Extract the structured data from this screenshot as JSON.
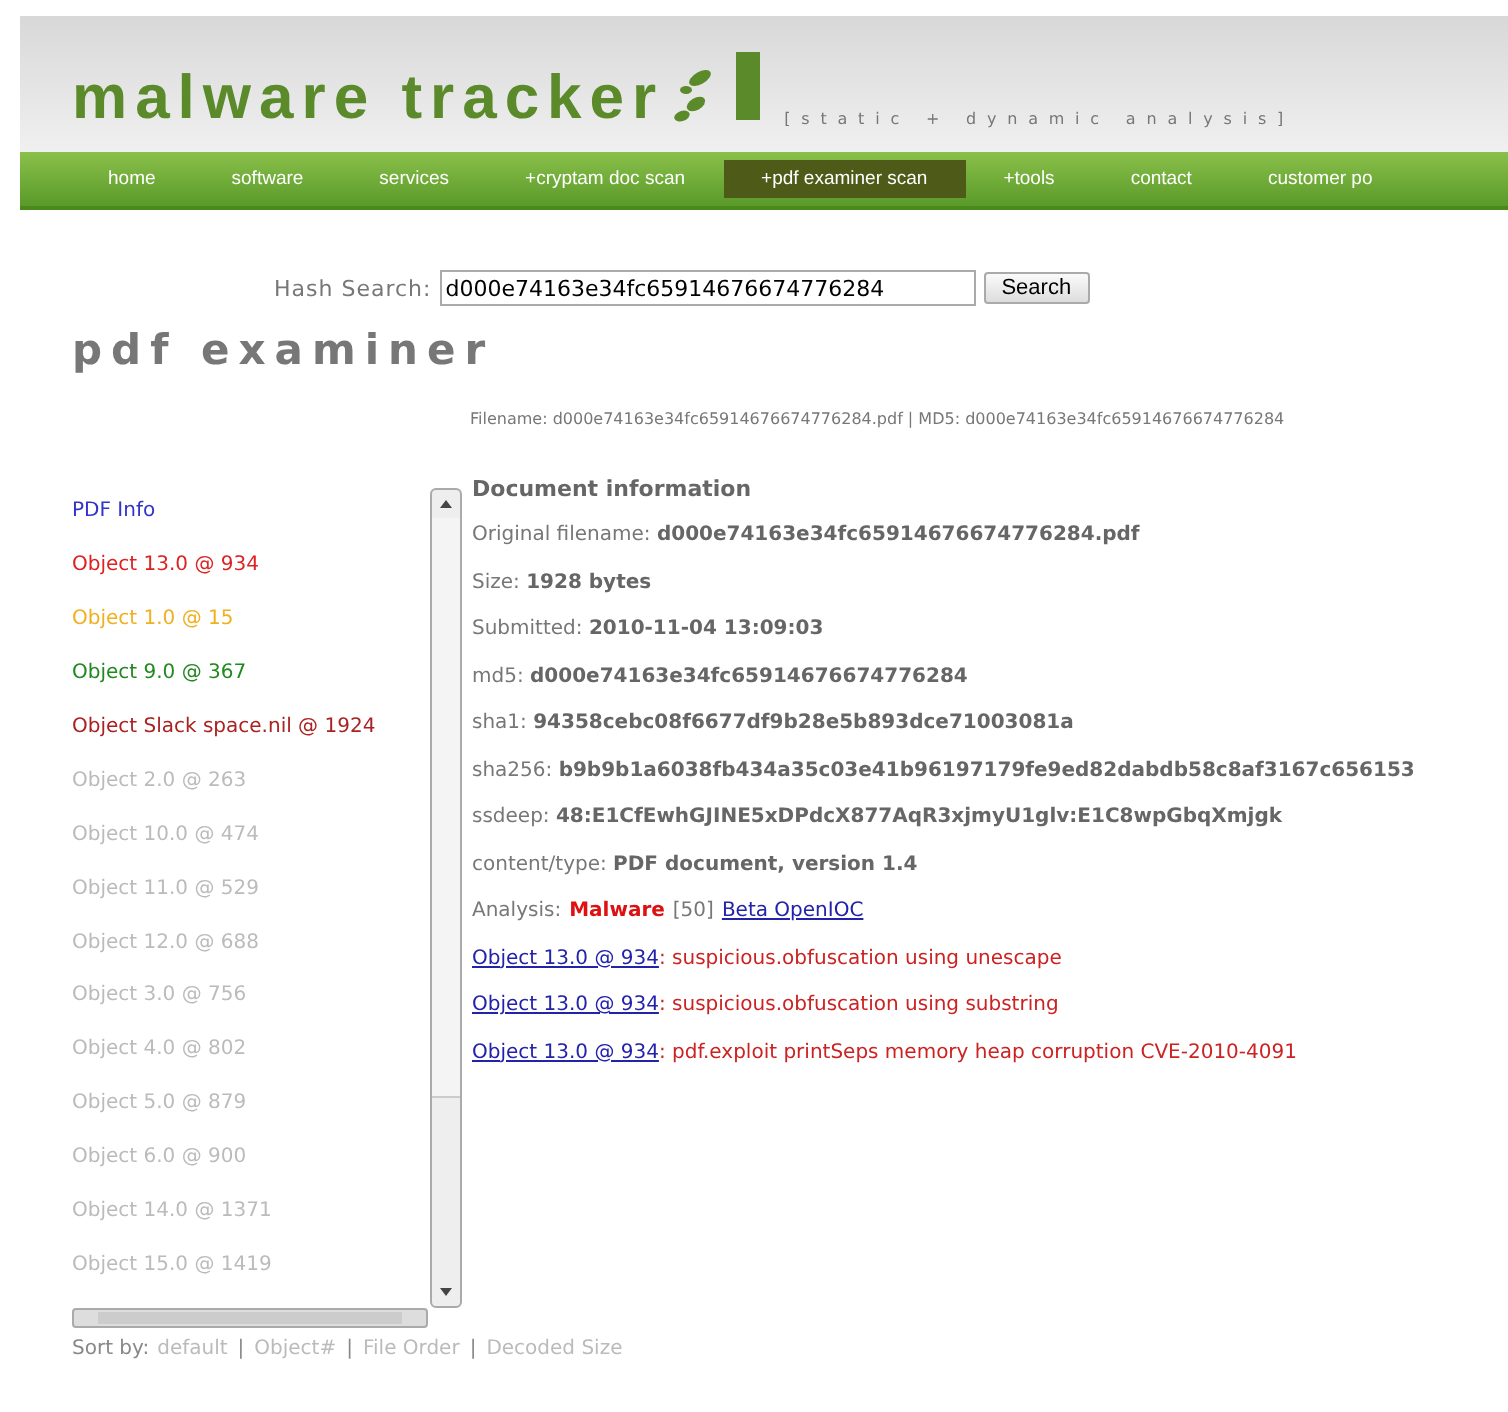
{
  "logo": {
    "name": "malware tracker",
    "tagline": "[static + dynamic analysis]"
  },
  "nav": [
    {
      "label": "home",
      "selected": false
    },
    {
      "label": "software",
      "selected": false
    },
    {
      "label": "services",
      "selected": false
    },
    {
      "label": "+cryptam doc scan",
      "selected": false
    },
    {
      "label": "+pdf examiner scan",
      "selected": true
    },
    {
      "label": "+tools",
      "selected": false
    },
    {
      "label": "contact",
      "selected": false
    },
    {
      "label": "customer po",
      "selected": false
    }
  ],
  "search": {
    "label": "Hash Search:",
    "value": "d000e74163e34fc65914676674776284",
    "button": "Search"
  },
  "page_title": "pdf examiner",
  "file_line": "Filename: d000e74163e34fc65914676674776284.pdf | MD5: d000e74163e34fc65914676674776284",
  "objects": [
    {
      "label": "PDF Info",
      "color": "#3333cc"
    },
    {
      "label": "Object 13.0 @ 934",
      "color": "#dd2222"
    },
    {
      "label": "Object 1.0 @ 15",
      "color": "#f0b020"
    },
    {
      "label": "Object 9.0 @ 367",
      "color": "#228822"
    },
    {
      "label": "Object Slack space.nil @ 1924",
      "color": "#aa2222"
    },
    {
      "label": "Object 2.0 @ 263",
      "color": "#bbbbbb"
    },
    {
      "label": "Object 10.0 @ 474",
      "color": "#bbbbbb"
    },
    {
      "label": "Object 11.0 @ 529",
      "color": "#bbbbbb"
    },
    {
      "label": "Object 12.0 @ 688",
      "color": "#bbbbbb"
    },
    {
      "label": "Object 3.0 @ 756",
      "color": "#bbbbbb"
    },
    {
      "label": "Object 4.0 @ 802",
      "color": "#bbbbbb"
    },
    {
      "label": "Object 5.0 @ 879",
      "color": "#bbbbbb"
    },
    {
      "label": "Object 6.0 @ 900",
      "color": "#bbbbbb"
    },
    {
      "label": "Object 14.0 @ 1371",
      "color": "#bbbbbb"
    },
    {
      "label": "Object 15.0 @ 1419",
      "color": "#bbbbbb"
    }
  ],
  "sort": {
    "label": "Sort by:",
    "separator": "|",
    "options": [
      "default",
      "Object#",
      "File Order",
      "Decoded Size"
    ]
  },
  "doc": {
    "heading": "Document information",
    "fields": [
      {
        "label": "Original filename:",
        "value": "d000e74163e34fc65914676674776284.pdf"
      },
      {
        "label": "Size:",
        "value": "1928 bytes"
      },
      {
        "label": "Submitted:",
        "value": "2010-11-04 13:09:03"
      },
      {
        "label": "md5:",
        "value": "d000e74163e34fc65914676674776284"
      },
      {
        "label": "sha1:",
        "value": "94358cebc08f6677df9b28e5b893dce71003081a"
      },
      {
        "label": "sha256:",
        "value": "b9b9b1a6038fb434a35c03e41b96197179fe9ed82dabdb58c8af3167c656153"
      },
      {
        "label": "ssdeep:",
        "value": "48:E1CfEwhGJINE5xDPdcX877AqR3xjmyU1glv:E1C8wpGbqXmjgk"
      },
      {
        "label": "content/type:",
        "value": "PDF document, version 1.4"
      }
    ],
    "analysis": {
      "label": "Analysis:",
      "verdict": "Malware",
      "score": "[50]",
      "link": "Beta OpenIOC"
    },
    "findings": [
      {
        "object": "Object 13.0 @ 934",
        "text": ": suspicious.obfuscation using unescape"
      },
      {
        "object": "Object 13.0 @ 934",
        "text": ": suspicious.obfuscation using substring"
      },
      {
        "object": "Object 13.0 @ 934",
        "text": ": pdf.exploit printSeps memory heap corruption CVE-2010-4091"
      }
    ]
  }
}
